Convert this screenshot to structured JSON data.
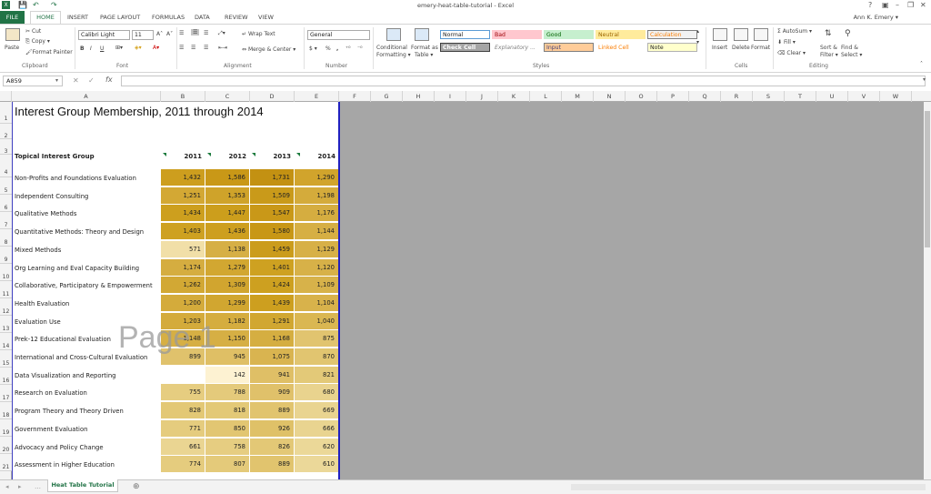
{
  "window": {
    "title": "emery-heat-table-tutorial - Excel",
    "help": "?",
    "minimize": "–",
    "restore": "❐",
    "close": "✕"
  },
  "qat": {
    "save": "💾",
    "undo": "↶",
    "redo": "↷"
  },
  "tabs": [
    "FILE",
    "HOME",
    "INSERT",
    "PAGE LAYOUT",
    "FORMULAS",
    "DATA",
    "REVIEW",
    "VIEW"
  ],
  "user": "Ann K. Emery ▾",
  "ribbon": {
    "clipboard": {
      "label": "Clipboard",
      "paste": "Paste",
      "cut": "Cut",
      "copy": "Copy ▾",
      "format_painter": "Format Painter"
    },
    "font": {
      "label": "Font",
      "name": "Calibri Light",
      "size": "11",
      "grow": "A˄",
      "shrink": "A˅",
      "bold": "B",
      "italic": "I",
      "underline": "U"
    },
    "alignment": {
      "label": "Alignment",
      "wrap": "Wrap Text",
      "merge": "Merge & Center ▾"
    },
    "number": {
      "label": "Number",
      "format": "General",
      "currency": "$ ▾",
      "percent": "%",
      "comma": ","
    },
    "styles": {
      "label": "Styles",
      "cond": "Conditional",
      "cond2": "Formatting ▾",
      "fmt_table": "Format as",
      "fmt_table2": "Table ▾",
      "cells": [
        {
          "name": "Normal",
          "bg": "#ffffff",
          "fg": "#222222",
          "border": "#5b9bd5"
        },
        {
          "name": "Bad",
          "bg": "#ffc7ce",
          "fg": "#9c0006",
          "border": "#ffc7ce"
        },
        {
          "name": "Good",
          "bg": "#c6efce",
          "fg": "#006100",
          "border": "#c6efce"
        },
        {
          "name": "Neutral",
          "bg": "#ffeb9c",
          "fg": "#9c6500",
          "border": "#ffeb9c"
        },
        {
          "name": "Calculation",
          "bg": "#f2f2f2",
          "fg": "#fa7d00",
          "border": "#7f7f7f"
        },
        {
          "name": "Check Cell",
          "bg": "#a5a5a5",
          "fg": "#ffffff",
          "border": "#3f3f3f"
        },
        {
          "name": "Explanatory ...",
          "bg": "#ffffff",
          "fg": "#7f7f7f",
          "border": "#ffffff"
        },
        {
          "name": "Input",
          "bg": "#ffcc99",
          "fg": "#3f3f76",
          "border": "#7f7f7f"
        },
        {
          "name": "Linked Cell",
          "bg": "#ffffff",
          "fg": "#fa7d00",
          "border": "#ffffff"
        },
        {
          "name": "Note",
          "bg": "#ffffcc",
          "fg": "#222222",
          "border": "#b2b2b2"
        }
      ]
    },
    "cells": {
      "label": "Cells",
      "insert": "Insert",
      "delete": "Delete",
      "format": "Format"
    },
    "editing": {
      "label": "Editing",
      "autosum": "AutoSum ▾",
      "fill": "Fill ▾",
      "clear": "Clear ▾",
      "sort": "Sort &",
      "sort2": "Filter ▾",
      "find": "Find &",
      "find2": "Select ▾"
    }
  },
  "namebox": "A859",
  "fx": "fx",
  "columns": [
    "A",
    "B",
    "C",
    "D",
    "E",
    "F",
    "G",
    "H",
    "I",
    "J",
    "K",
    "L",
    "M",
    "N",
    "O",
    "P",
    "Q",
    "R",
    "S",
    "T",
    "U",
    "V",
    "W"
  ],
  "sheet": {
    "title": "Interest Group Membership, 2011 through 2014",
    "header_label": "Topical Interest Group",
    "years": [
      "2011",
      "2012",
      "2013",
      "2014"
    ],
    "rows": [
      {
        "label": "Non-Profits and Foundations Evaluation",
        "values": [
          "1,432",
          "1,586",
          "1,731",
          "1,290"
        ],
        "colors": [
          "#cd9e1e",
          "#c99817",
          "#c39112",
          "#d1a42c"
        ]
      },
      {
        "label": "Independent Consulting",
        "values": [
          "1,251",
          "1,353",
          "1,509",
          "1,198"
        ],
        "colors": [
          "#d3a834",
          "#cfa32a",
          "#c99a1a",
          "#d4ab3b"
        ]
      },
      {
        "label": "Qualitative Methods",
        "values": [
          "1,434",
          "1,447",
          "1,547",
          "1,176"
        ],
        "colors": [
          "#cd9f1e",
          "#cc9e1c",
          "#c99818",
          "#d5ad40"
        ]
      },
      {
        "label": "Quantitative Methods: Theory and Design",
        "values": [
          "1,403",
          "1,436",
          "1,580",
          "1,144"
        ],
        "colors": [
          "#cea121",
          "#cd9f1f",
          "#c89716",
          "#d6af44"
        ]
      },
      {
        "label": "Mixed Methods",
        "values": [
          "571",
          "1,138",
          "1,459",
          "1,129"
        ],
        "colors": [
          "#f1dfa8",
          "#d6af45",
          "#cb9c1c",
          "#d7b047"
        ]
      },
      {
        "label": "Org Learning and Eval Capacity Building",
        "values": [
          "1,174",
          "1,279",
          "1,401",
          "1,120"
        ],
        "colors": [
          "#d5ad40",
          "#d2a731",
          "#cea121",
          "#d7b148"
        ]
      },
      {
        "label": "Collaborative, Participatory & Empowerment",
        "values": [
          "1,262",
          "1,309",
          "1,424",
          "1,109"
        ],
        "colors": [
          "#d2a834",
          "#d1a52f",
          "#cda020",
          "#d7b24a"
        ]
      },
      {
        "label": "Health Evaluation",
        "values": [
          "1,200",
          "1,299",
          "1,439",
          "1,104"
        ],
        "colors": [
          "#d4ab3b",
          "#d1a630",
          "#cd9f1f",
          "#d8b24b"
        ]
      },
      {
        "label": "Evaluation Use",
        "values": [
          "1,203",
          "1,182",
          "1,291",
          "1,040"
        ],
        "colors": [
          "#d4ab3b",
          "#d5ad3f",
          "#d1a731",
          "#dab752"
        ]
      },
      {
        "label": "Prek-12 Educational Evaluation",
        "values": [
          "1,148",
          "1,150",
          "1,168",
          "875"
        ],
        "colors": [
          "#d6af44",
          "#d6af44",
          "#d5ae41",
          "#e1c46f"
        ]
      },
      {
        "label": "International and Cross-Cultural Evaluation",
        "values": [
          "899",
          "945",
          "1,075",
          "870"
        ],
        "colors": [
          "#e0c26c",
          "#dfbf65",
          "#d9b450",
          "#e1c570"
        ]
      },
      {
        "label": "Data Visualization and Reporting",
        "values": [
          "",
          "142",
          "941",
          "821"
        ],
        "colors": [
          "#ffffff",
          "#fdf2d2",
          "#dfbf66",
          "#e3c978"
        ]
      },
      {
        "label": "Research on Evaluation",
        "values": [
          "755",
          "788",
          "909",
          "680"
        ],
        "colors": [
          "#e6cd80",
          "#e4ca7b",
          "#e0c16a",
          "#e9d38e"
        ]
      },
      {
        "label": "Program Theory and Theory Driven",
        "values": [
          "828",
          "818",
          "889",
          "669"
        ],
        "colors": [
          "#e3c875",
          "#e3c977",
          "#e1c46e",
          "#e9d490"
        ]
      },
      {
        "label": "Government Evaluation",
        "values": [
          "771",
          "850",
          "926",
          "666"
        ],
        "colors": [
          "#e5cc7e",
          "#e2c672",
          "#dfc168",
          "#e9d490"
        ]
      },
      {
        "label": "Advocacy and Policy Change",
        "values": [
          "661",
          "758",
          "826",
          "620"
        ],
        "colors": [
          "#ead592",
          "#e6cd81",
          "#e3c876",
          "#ebd898"
        ]
      },
      {
        "label": "Assessment in Higher Education",
        "values": [
          "774",
          "807",
          "889",
          "610"
        ],
        "colors": [
          "#e5cc7e",
          "#e4ca7a",
          "#e1c46e",
          "#ebd899"
        ]
      }
    ]
  },
  "row_numbers": [
    "1",
    "2",
    "3",
    "4",
    "5",
    "6",
    "7",
    "8",
    "9",
    "10",
    "11",
    "12",
    "13",
    "14",
    "15",
    "16",
    "17",
    "18",
    "19",
    "20",
    "21"
  ],
  "watermark": "Page 1",
  "sheet_tab": "Heat Table Tutorial",
  "add_sheet": "⊕"
}
